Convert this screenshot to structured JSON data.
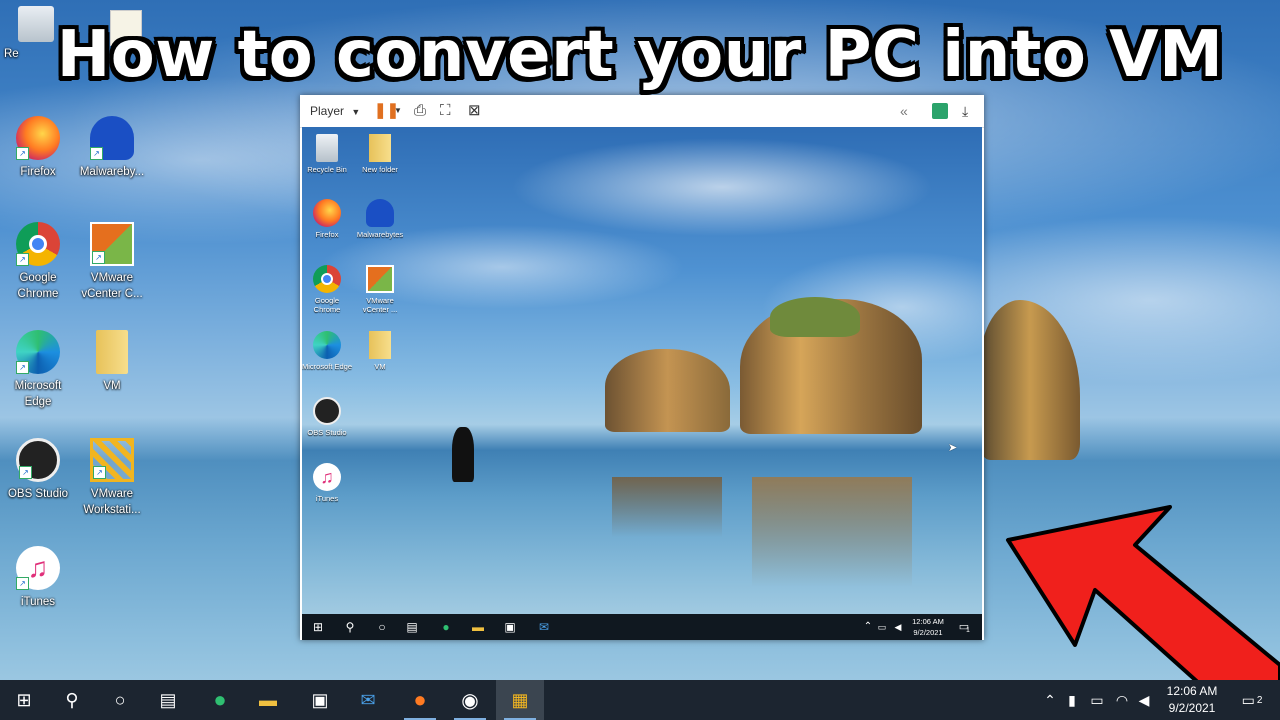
{
  "title": "How to convert your PC into VM",
  "desktop_icons": [
    {
      "label": "Re",
      "icon": "recycle-bin-icon"
    },
    {
      "label": "Firefox",
      "icon": "firefox-icon"
    },
    {
      "label": "Malwareby...",
      "icon": "malwarebytes-icon"
    },
    {
      "label": "Google Chrome",
      "icon": "chrome-icon"
    },
    {
      "label": "VMware vCenter C...",
      "icon": "vmware-vcenter-icon"
    },
    {
      "label": "Microsoft Edge",
      "icon": "edge-icon"
    },
    {
      "label": "VM",
      "icon": "folder-icon"
    },
    {
      "label": "OBS Studio",
      "icon": "obs-icon"
    },
    {
      "label": "VMware Workstati...",
      "icon": "vmware-workstation-icon"
    },
    {
      "label": "iTunes",
      "icon": "itunes-icon"
    }
  ],
  "vm_window": {
    "toolbar": {
      "player_label": "Player",
      "pause_icon": "pause-icon",
      "send_keys_icon": "send-ctrl-alt-del-icon",
      "fit_icon": "fit-guest-icon",
      "unity_icon": "unity-icon",
      "collapse_icon": "double-chevron-left-icon",
      "notes_icon": "notes-icon",
      "download_icon": "download-icon"
    },
    "desktop_icons": [
      {
        "label": "Recycle Bin"
      },
      {
        "label": "New folder"
      },
      {
        "label": "Firefox"
      },
      {
        "label": "Malwarebytes"
      },
      {
        "label": "Google Chrome"
      },
      {
        "label": "VMware vCenter ..."
      },
      {
        "label": "Microsoft Edge"
      },
      {
        "label": "VM"
      },
      {
        "label": "OBS Studio"
      },
      {
        "label": "iTunes"
      }
    ],
    "taskbar": {
      "time": "12:06 AM",
      "date": "9/2/2021",
      "notification_count": "1"
    }
  },
  "taskbar": {
    "time": "12:06 AM",
    "date": "9/2/2021",
    "notification_count": "2"
  },
  "colors": {
    "arrow": "#f0201c",
    "taskbar": "#1c2530",
    "accent": "#7fb0e0"
  }
}
